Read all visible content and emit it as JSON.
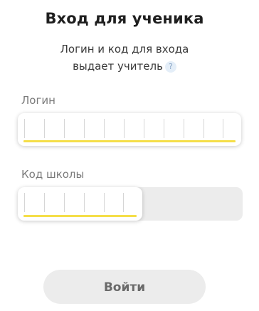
{
  "title": "Вход для ученика",
  "subtitle_line1": "Логин и код для входа",
  "subtitle_line2": "выдает учитель",
  "help_icon": "?",
  "login": {
    "label": "Логин",
    "value": "",
    "cell_count": 10
  },
  "school_code": {
    "label": "Код школы",
    "value": "",
    "cell_count": 5
  },
  "submit_label": "Войти",
  "colors": {
    "accent_underline": "#f5de49",
    "button_bg": "#ececec",
    "help_icon_bg": "#e4eef8"
  }
}
